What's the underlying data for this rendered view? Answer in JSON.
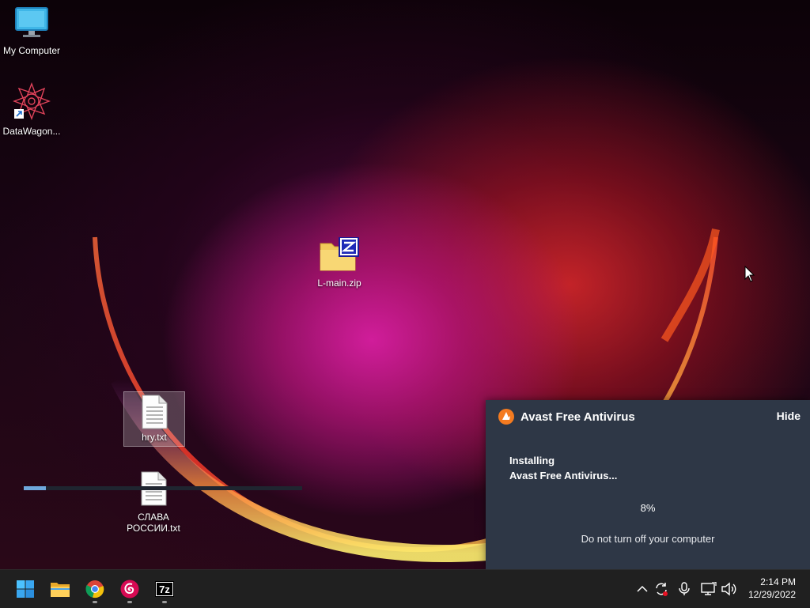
{
  "desktop": {
    "icons": [
      {
        "label": "My Computer",
        "icon": "monitor-icon"
      },
      {
        "label": "DataWagon...",
        "icon": "datawagon-shortcut-icon"
      },
      {
        "label": "L-main.zip",
        "icon": "zip-folder-icon"
      },
      {
        "label": "hry.txt",
        "icon": "text-file-icon",
        "selected": true
      },
      {
        "label": "СЛАВА РОССИИ.txt",
        "label_lines": [
          "СЛАВА",
          "РОССИИ.txt"
        ],
        "icon": "text-file-icon"
      }
    ]
  },
  "avast_toast": {
    "title": "Avast Free Antivirus",
    "hide_label": "Hide",
    "status_line1": "Installing",
    "status_line2": "Avast Free Antivirus...",
    "percent_label": "8%",
    "progress_fraction": 0.08,
    "note": "Do not turn off your computer",
    "colors": {
      "background": "#2e3746",
      "progress": "#6fa8dc",
      "logo": "#f47b20"
    }
  },
  "taskbar": {
    "apps": [
      {
        "name": "Start",
        "icon": "windows-start-icon",
        "running": false
      },
      {
        "name": "File Explorer",
        "icon": "folder-icon",
        "running": false
      },
      {
        "name": "Google Chrome",
        "icon": "chrome-icon",
        "running": true
      },
      {
        "name": "Debian",
        "icon": "debian-icon",
        "running": true
      },
      {
        "name": "7-Zip",
        "icon": "7zip-icon",
        "label": "7z",
        "running": true
      }
    ],
    "tray": {
      "icons": [
        "chevron-up-icon",
        "sync-icon",
        "microphone-icon",
        "network-icon",
        "volume-icon"
      ]
    },
    "clock": {
      "time": "2:14 PM",
      "date": "12/29/2022"
    }
  }
}
